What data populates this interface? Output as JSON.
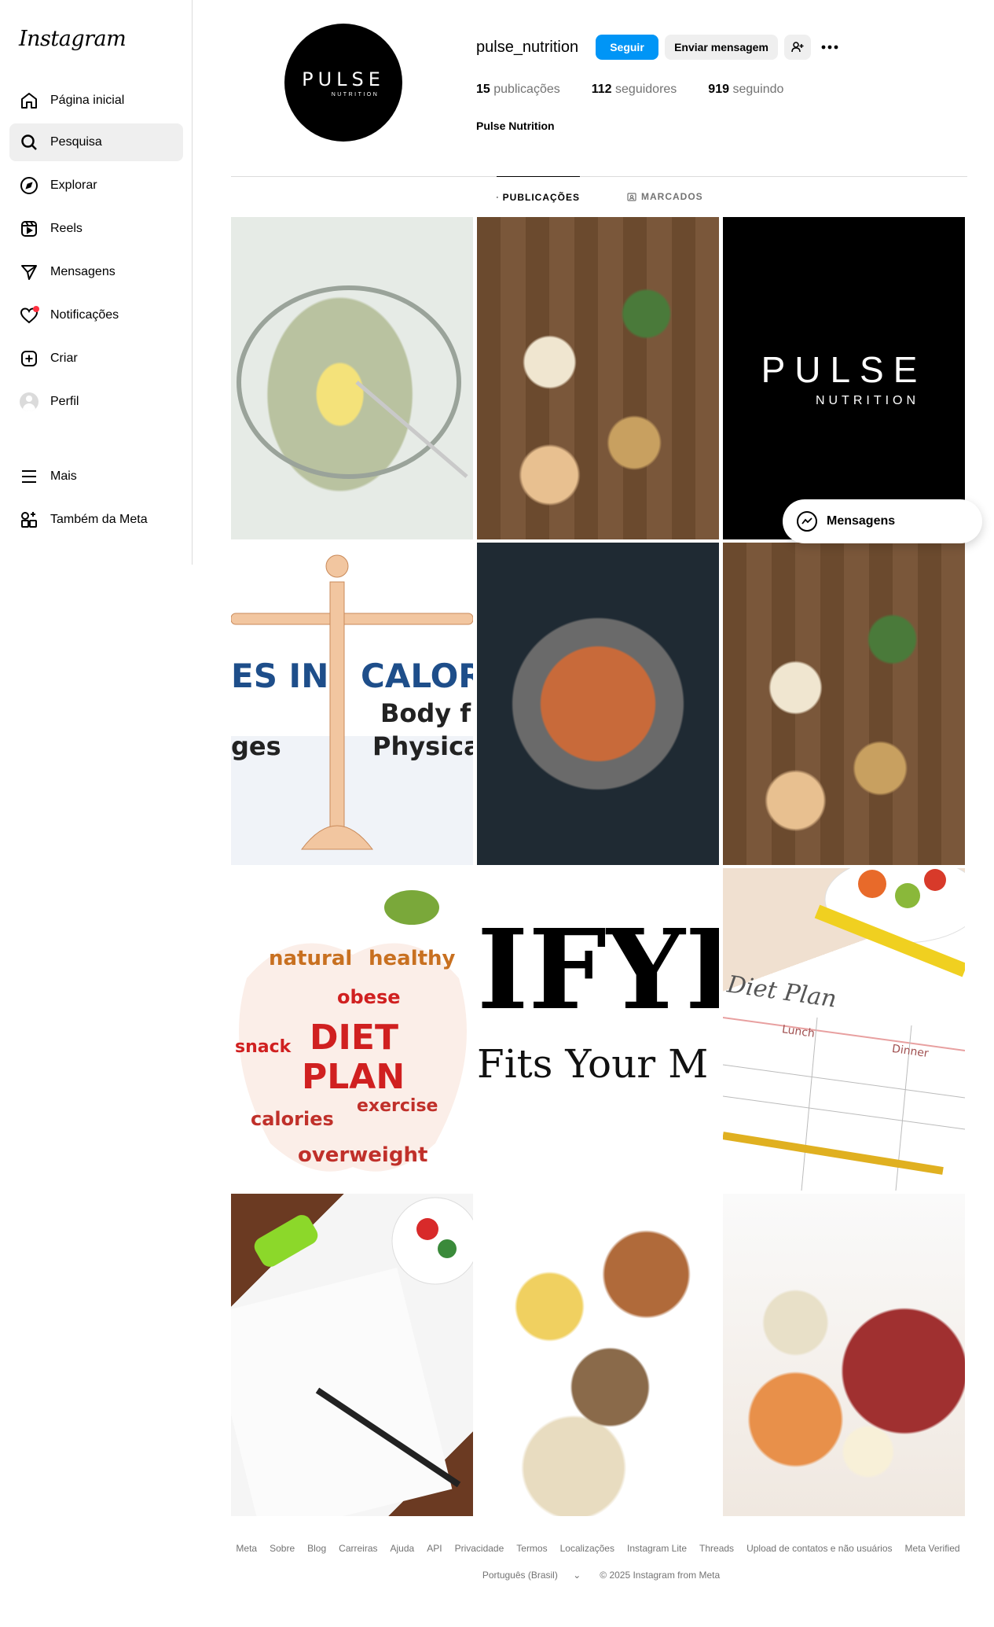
{
  "app": {
    "logo": "Instagram"
  },
  "sidebar": {
    "items": [
      {
        "label": "Página inicial",
        "icon": "home-icon"
      },
      {
        "label": "Pesquisa",
        "icon": "search-icon"
      },
      {
        "label": "Explorar",
        "icon": "compass-icon"
      },
      {
        "label": "Reels",
        "icon": "reels-icon"
      },
      {
        "label": "Mensagens",
        "icon": "send-icon"
      },
      {
        "label": "Notificações",
        "icon": "heart-icon"
      },
      {
        "label": "Criar",
        "icon": "plus-square-icon"
      },
      {
        "label": "Perfil",
        "icon": "avatar"
      },
      {
        "label": "Mais",
        "icon": "menu-icon"
      },
      {
        "label": "Também da Meta",
        "icon": "meta-apps-icon"
      }
    ]
  },
  "profile": {
    "username": "pulse_nutrition",
    "full_name": "Pulse Nutrition",
    "avatar_logo_word": "PULSE",
    "avatar_logo_sub": "NUTRITION",
    "follow_label": "Seguir",
    "message_label": "Enviar mensagem",
    "stats": {
      "posts_count": "15",
      "posts_label": "publicações",
      "followers_count": "112",
      "followers_label": "seguidores",
      "following_count": "919",
      "following_label": "seguindo"
    }
  },
  "tabs": {
    "posts": "PUBLICAÇÕES",
    "tagged": "MARCADOS"
  },
  "posts": {
    "black_word": "PULSE",
    "black_sub": "NUTRITION",
    "scale_text1": "ES IN",
    "scale_text2": "CALOR",
    "scale_text3": "Body f",
    "scale_text4": "ges",
    "scale_text5": "Physica",
    "apple_word1": "DIET",
    "apple_word2": "PLAN",
    "apple_word3": "healthy",
    "apple_word4": "natural",
    "apple_word5": "calories",
    "apple_word6": "overweight",
    "apple_word7": "exercise",
    "apple_word8": "snack",
    "apple_word9": "obese",
    "iifym_big": "IFYI",
    "iifym_small": "Fits Your M",
    "diet_title": "Diet Plan",
    "diet_col1": "Lunch",
    "diet_col2": "Dinner"
  },
  "messages_pill": {
    "label": "Mensagens"
  },
  "footer": {
    "links": [
      "Meta",
      "Sobre",
      "Blog",
      "Carreiras",
      "Ajuda",
      "API",
      "Privacidade",
      "Termos",
      "Localizações",
      "Instagram Lite",
      "Threads",
      "Upload de contatos e não usuários",
      "Meta Verified"
    ],
    "language": "Português (Brasil)",
    "copyright": "© 2025 Instagram from Meta"
  },
  "colors": {
    "accent": "#0095f6",
    "notification_dot": "#ff3040"
  }
}
